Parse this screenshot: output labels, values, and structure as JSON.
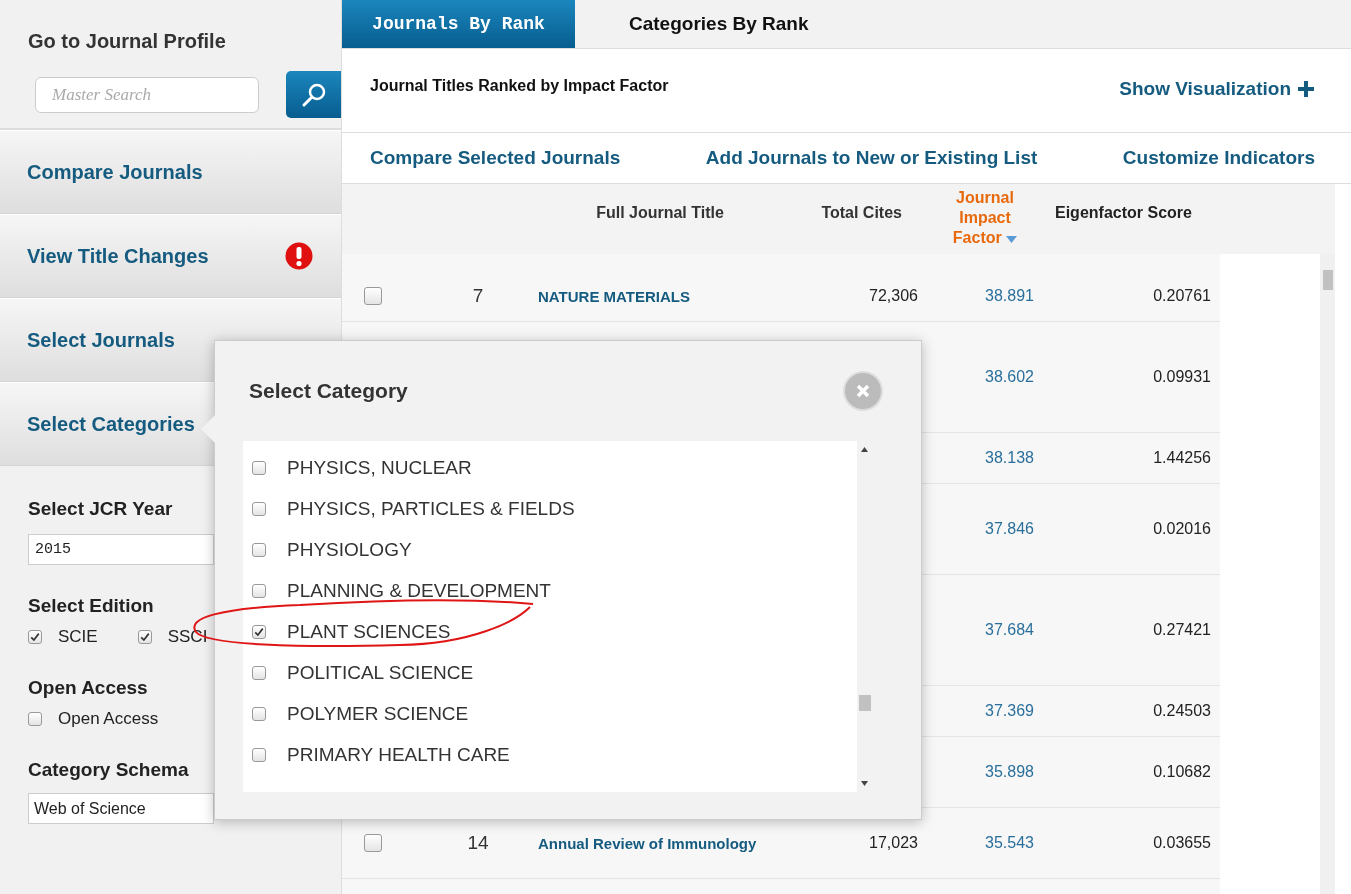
{
  "sidebar": {
    "profile_title": "Go to Journal Profile",
    "search": {
      "placeholder": "Master Search"
    },
    "nav_items": [
      {
        "label": "Compare Journals",
        "alert": false
      },
      {
        "label": "View Title Changes",
        "alert": true
      },
      {
        "label": "Select Journals",
        "alert": false
      },
      {
        "label": "Select Categories",
        "alert": false
      }
    ],
    "jcr_year": {
      "label": "Select JCR Year",
      "value": "2015"
    },
    "edition": {
      "label": "Select Edition",
      "options": [
        {
          "label": "SCIE",
          "checked": true
        },
        {
          "label": "SSCI",
          "checked": true
        }
      ]
    },
    "open_access": {
      "label": "Open Access",
      "options": [
        {
          "label": "Open Access",
          "checked": false
        }
      ]
    },
    "category_schema": {
      "label": "Category Schema",
      "value": "Web of Science"
    }
  },
  "tabs": [
    {
      "label": "Journals By Rank",
      "selected": true
    },
    {
      "label": "Categories By Rank",
      "selected": false
    }
  ],
  "header": {
    "title": "Journal Titles Ranked by Impact Factor",
    "visualization_link": "Show Visualization"
  },
  "actions": [
    "Compare Selected Journals",
    "Add Journals to New or Existing List",
    "Customize Indicators"
  ],
  "table": {
    "columns": [
      {
        "label": "Full Journal Title",
        "sorted": false
      },
      {
        "label": "Total Cites",
        "sorted": false
      },
      {
        "label": "Journal Impact Factor",
        "sorted": true
      },
      {
        "label": "Eigenfactor Score",
        "sorted": false
      }
    ],
    "rows": [
      {
        "checked": false,
        "rank": "7",
        "title": "NATURE MATERIALS",
        "cites": "72,306",
        "impact": "38.891",
        "eigenfactor": "0.20761"
      },
      {
        "impact": "38.602",
        "eigenfactor": "0.09931"
      },
      {
        "impact": "38.138",
        "eigenfactor": "1.44256"
      },
      {
        "impact": "37.846",
        "eigenfactor": "0.02016"
      },
      {
        "impact": "37.684",
        "eigenfactor": "0.27421"
      },
      {
        "impact": "37.369",
        "eigenfactor": "0.24503"
      },
      {
        "impact": "35.898",
        "eigenfactor": "0.10682"
      },
      {
        "checked": false,
        "rank": "14",
        "title": "Annual Review of Immunology",
        "cites": "17,023",
        "impact": "35.543",
        "eigenfactor": "0.03655"
      }
    ]
  },
  "modal": {
    "title": "Select Category",
    "items": [
      {
        "label": "PHYSICS, NUCLEAR",
        "checked": false
      },
      {
        "label": "PHYSICS, PARTICLES & FIELDS",
        "checked": false
      },
      {
        "label": "PHYSIOLOGY",
        "checked": false
      },
      {
        "label": "PLANNING & DEVELOPMENT",
        "checked": false
      },
      {
        "label": "PLANT SCIENCES",
        "checked": true
      },
      {
        "label": "POLITICAL SCIENCE",
        "checked": false
      },
      {
        "label": "POLYMER SCIENCE",
        "checked": false
      },
      {
        "label": "PRIMARY HEALTH CARE",
        "checked": false
      }
    ]
  }
}
